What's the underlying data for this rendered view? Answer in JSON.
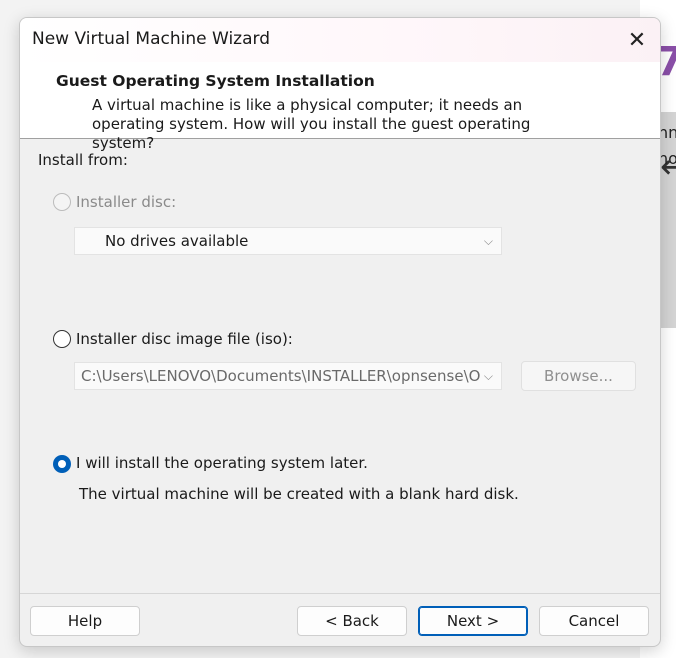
{
  "background_app": {
    "brand_glyph": "7",
    "arrow_glyph": "←",
    "line1": "nn",
    "line2": "no"
  },
  "window": {
    "title": "New Virtual Machine Wizard",
    "close_glyph": "✕"
  },
  "header": {
    "title": "Guest Operating System Installation",
    "description": "A virtual machine is like a physical computer; it needs an operating system. How will you install the guest operating system?"
  },
  "install_from_label": "Install from:",
  "options": {
    "installer_disc": {
      "label": "Installer disc:",
      "selected": false,
      "enabled": false,
      "dropdown_value": "No drives available"
    },
    "iso": {
      "label": "Installer disc image file (iso):",
      "selected": false,
      "path_value": "C:\\Users\\LENOVO\\Documents\\INSTALLER\\opnsense\\O",
      "browse_label": "Browse..."
    },
    "later": {
      "label": "I will install the operating system later.",
      "selected": true,
      "note": "The virtual machine will be created with a blank hard disk."
    }
  },
  "chevron_glyph": "⌵",
  "buttons": {
    "help": "Help",
    "back": "< Back",
    "next": "Next >",
    "cancel": "Cancel"
  },
  "colors": {
    "accent": "#005fb8",
    "brand": "#8a4fa8"
  }
}
